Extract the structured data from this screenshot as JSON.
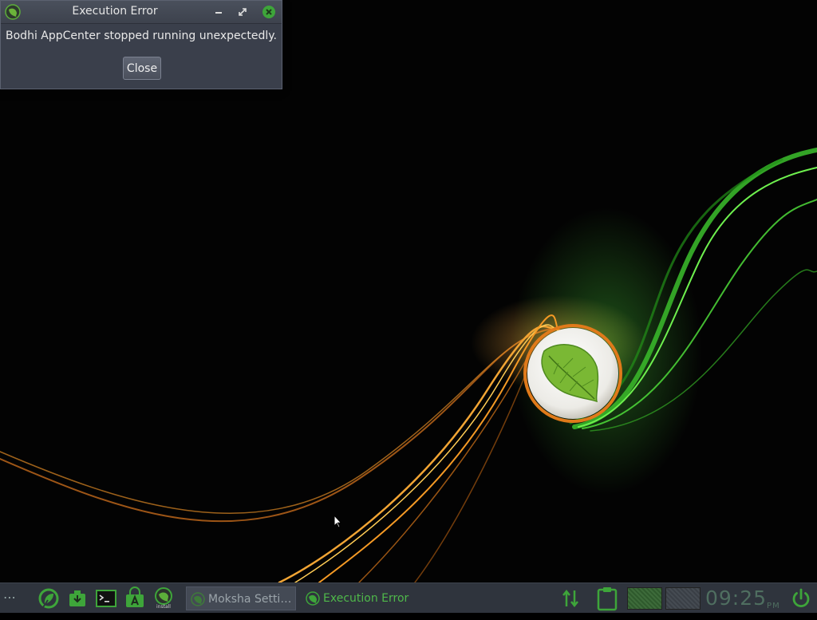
{
  "dialog": {
    "title": "Execution Error",
    "message": "Bodhi AppCenter stopped running unexpectedly.",
    "close_label": "Close",
    "buttons": [
      "minimize-icon",
      "maximize-icon",
      "close-icon"
    ]
  },
  "taskbar": {
    "launchers": [
      "bodhi-menu-icon",
      "downloads-icon",
      "terminal-icon",
      "appcenter-icon",
      "install-icon"
    ],
    "install_label": "install",
    "tasks": [
      {
        "label": "Moksha Setti…",
        "state": "inactive"
      },
      {
        "label": "Execution Error",
        "state": "active"
      }
    ],
    "tray": [
      "network-icon",
      "clipboard-icon"
    ],
    "pagers": [
      {
        "active": true
      },
      {
        "active": false
      }
    ],
    "clock": {
      "time": "09:25",
      "ampm": "PM"
    }
  },
  "colors": {
    "accent": "#4fb84a",
    "taskbar_bg": "#2f343d",
    "dialog_bg": "#3a3f4b",
    "wallpaper_orange": "#f0a020",
    "wallpaper_green": "#44cc33"
  }
}
